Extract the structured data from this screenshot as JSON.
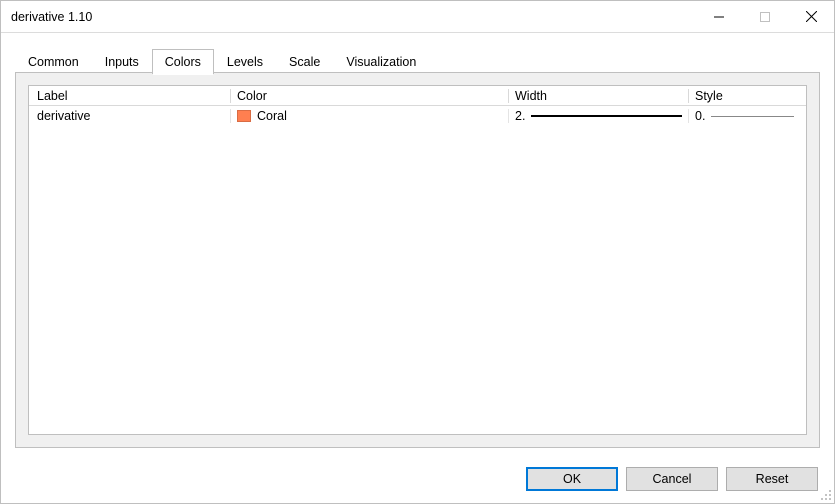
{
  "window": {
    "title": "derivative 1.10"
  },
  "tabs": [
    {
      "label": "Common"
    },
    {
      "label": "Inputs"
    },
    {
      "label": "Colors"
    },
    {
      "label": "Levels"
    },
    {
      "label": "Scale"
    },
    {
      "label": "Visualization"
    }
  ],
  "active_tab_index": 2,
  "grid": {
    "headers": {
      "label": "Label",
      "color": "Color",
      "width": "Width",
      "style": "Style"
    },
    "rows": [
      {
        "label": "derivative",
        "color_name": "Coral",
        "color_hex": "#ff7f50",
        "width_value": "2.",
        "style_value": "0."
      }
    ]
  },
  "buttons": {
    "ok": "OK",
    "cancel": "Cancel",
    "reset": "Reset"
  }
}
